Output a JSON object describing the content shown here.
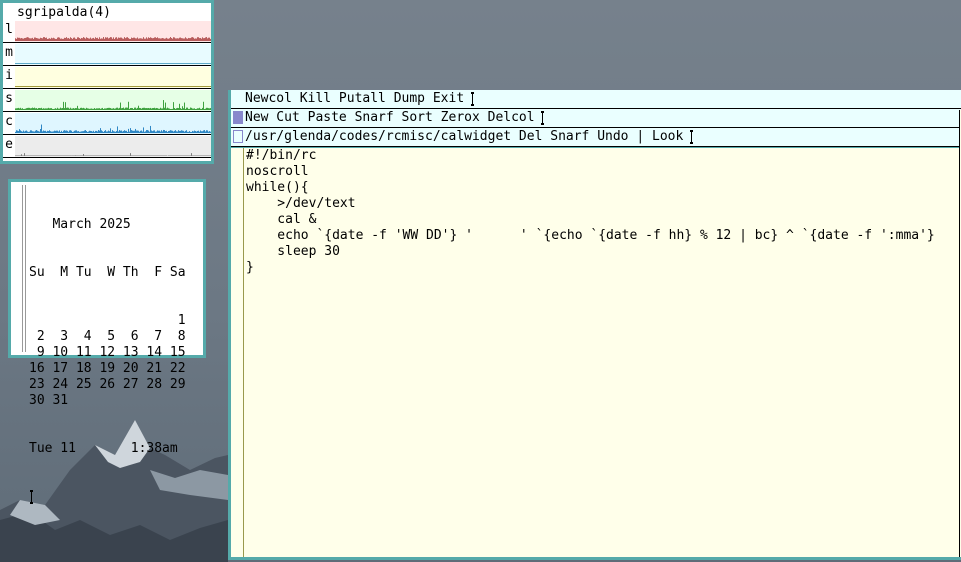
{
  "stats": {
    "title": "sgripalda(4)",
    "rows": [
      {
        "label": "l",
        "bg": "#ffe6e6",
        "color": "#b85c5c"
      },
      {
        "label": "m",
        "bg": "#e8fbff",
        "color": "#5fa9c9"
      },
      {
        "label": "i",
        "bg": "#ffffe0",
        "color": "#a39a3c"
      },
      {
        "label": "s",
        "bg": "#e6ffe6",
        "color": "#3fa23f"
      },
      {
        "label": "c",
        "bg": "#dff6ff",
        "color": "#2f87c5"
      },
      {
        "label": "e",
        "bg": "#ececec",
        "color": "#808080"
      }
    ]
  },
  "calendar": {
    "title": "   March 2025",
    "header": "Su  M Tu  W Th  F Sa",
    "weeks": [
      "                   1",
      " 2  3  4  5  6  7  8",
      " 9 10 11 12 13 14 15",
      "16 17 18 19 20 21 22",
      "23 24 25 26 27 28 29",
      "30 31"
    ],
    "footer": "Tue 11       1:38am"
  },
  "acme": {
    "main_tag": "Newcol Kill Putall Dump Exit ",
    "column_tag": "New Cut Paste Snarf Sort Zerox Delcol ",
    "window_tag": "/usr/glenda/codes/rcmisc/calwidget Del Snarf Undo | Look ",
    "body_lines": [
      "#!/bin/rc",
      "noscroll",
      "while(){",
      "    >/dev/text",
      "    cal &",
      "    echo `{date -f 'WW DD'} '      ' `{echo `{date -f hh} % 12 | bc} ^ `{date -f ':mma'}",
      "    sleep 30",
      "}"
    ]
  }
}
